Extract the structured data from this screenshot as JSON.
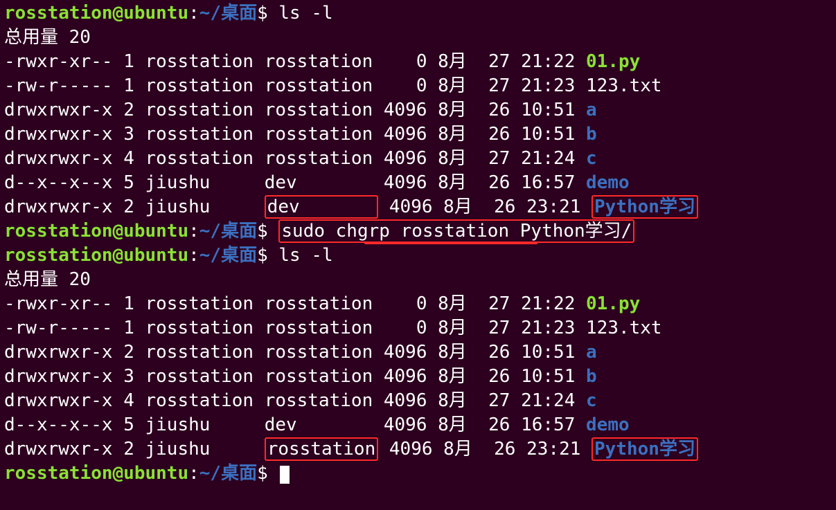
{
  "prompt": {
    "user": "rosstation@ubuntu",
    "sep": ":",
    "path": "~/桌面",
    "dollar": "$"
  },
  "cmd": {
    "ls": "ls -l",
    "sudo": "sudo chgrp rosstation Python学习/"
  },
  "total": "总用量 20",
  "listing1": [
    {
      "perm": "-rwxr-xr--",
      "lnk": "1",
      "own": "rosstation",
      "grp": "rosstation",
      "size": "   0",
      "mon": "8月",
      "day": "27",
      "time": "21:22",
      "name": "01.py",
      "cls": "file-exec",
      "box_name": false,
      "box_grp": false
    },
    {
      "perm": "-rw-r-----",
      "lnk": "1",
      "own": "rosstation",
      "grp": "rosstation",
      "size": "   0",
      "mon": "8月",
      "day": "27",
      "time": "21:23",
      "name": "123.txt",
      "cls": "file-reg",
      "box_name": false,
      "box_grp": false
    },
    {
      "perm": "drwxrwxr-x",
      "lnk": "2",
      "own": "rosstation",
      "grp": "rosstation",
      "size": "4096",
      "mon": "8月",
      "day": "26",
      "time": "10:51",
      "name": "a",
      "cls": "file-dir",
      "box_name": false,
      "box_grp": false
    },
    {
      "perm": "drwxrwxr-x",
      "lnk": "3",
      "own": "rosstation",
      "grp": "rosstation",
      "size": "4096",
      "mon": "8月",
      "day": "26",
      "time": "10:51",
      "name": "b",
      "cls": "file-dir",
      "box_name": false,
      "box_grp": false
    },
    {
      "perm": "drwxrwxr-x",
      "lnk": "4",
      "own": "rosstation",
      "grp": "rosstation",
      "size": "4096",
      "mon": "8月",
      "day": "27",
      "time": "21:24",
      "name": "c",
      "cls": "file-dir",
      "box_name": false,
      "box_grp": false
    },
    {
      "perm": "d--x--x--x",
      "lnk": "5",
      "own": "jiushu",
      "grp": "dev",
      "size": "4096",
      "mon": "8月",
      "day": "26",
      "time": "16:57",
      "name": "demo",
      "cls": "file-dir",
      "box_name": false,
      "box_grp": false
    },
    {
      "perm": "drwxrwxr-x",
      "lnk": "2",
      "own": "jiushu",
      "grp": "dev",
      "size": "4096",
      "mon": "8月",
      "day": "26",
      "time": "23:21",
      "name": "Python学习",
      "cls": "file-dir",
      "box_name": true,
      "box_grp": true
    }
  ],
  "listing2": [
    {
      "perm": "-rwxr-xr--",
      "lnk": "1",
      "own": "rosstation",
      "grp": "rosstation",
      "size": "   0",
      "mon": "8月",
      "day": "27",
      "time": "21:22",
      "name": "01.py",
      "cls": "file-exec",
      "box_name": false,
      "box_grp": false
    },
    {
      "perm": "-rw-r-----",
      "lnk": "1",
      "own": "rosstation",
      "grp": "rosstation",
      "size": "   0",
      "mon": "8月",
      "day": "27",
      "time": "21:23",
      "name": "123.txt",
      "cls": "file-reg",
      "box_name": false,
      "box_grp": false
    },
    {
      "perm": "drwxrwxr-x",
      "lnk": "2",
      "own": "rosstation",
      "grp": "rosstation",
      "size": "4096",
      "mon": "8月",
      "day": "26",
      "time": "10:51",
      "name": "a",
      "cls": "file-dir",
      "box_name": false,
      "box_grp": false
    },
    {
      "perm": "drwxrwxr-x",
      "lnk": "3",
      "own": "rosstation",
      "grp": "rosstation",
      "size": "4096",
      "mon": "8月",
      "day": "26",
      "time": "10:51",
      "name": "b",
      "cls": "file-dir",
      "box_name": false,
      "box_grp": false
    },
    {
      "perm": "drwxrwxr-x",
      "lnk": "4",
      "own": "rosstation",
      "grp": "rosstation",
      "size": "4096",
      "mon": "8月",
      "day": "27",
      "time": "21:24",
      "name": "c",
      "cls": "file-dir",
      "box_name": false,
      "box_grp": false
    },
    {
      "perm": "d--x--x--x",
      "lnk": "5",
      "own": "jiushu",
      "grp": "dev",
      "size": "4096",
      "mon": "8月",
      "day": "26",
      "time": "16:57",
      "name": "demo",
      "cls": "file-dir",
      "box_name": false,
      "box_grp": false
    },
    {
      "perm": "drwxrwxr-x",
      "lnk": "2",
      "own": "jiushu",
      "grp": "rosstation",
      "size": "4096",
      "mon": "8月",
      "day": "26",
      "time": "23:21",
      "name": "Python学习",
      "cls": "file-dir",
      "box_name": true,
      "box_grp": true
    }
  ],
  "cols": {
    "own": 10,
    "grp": 10
  }
}
